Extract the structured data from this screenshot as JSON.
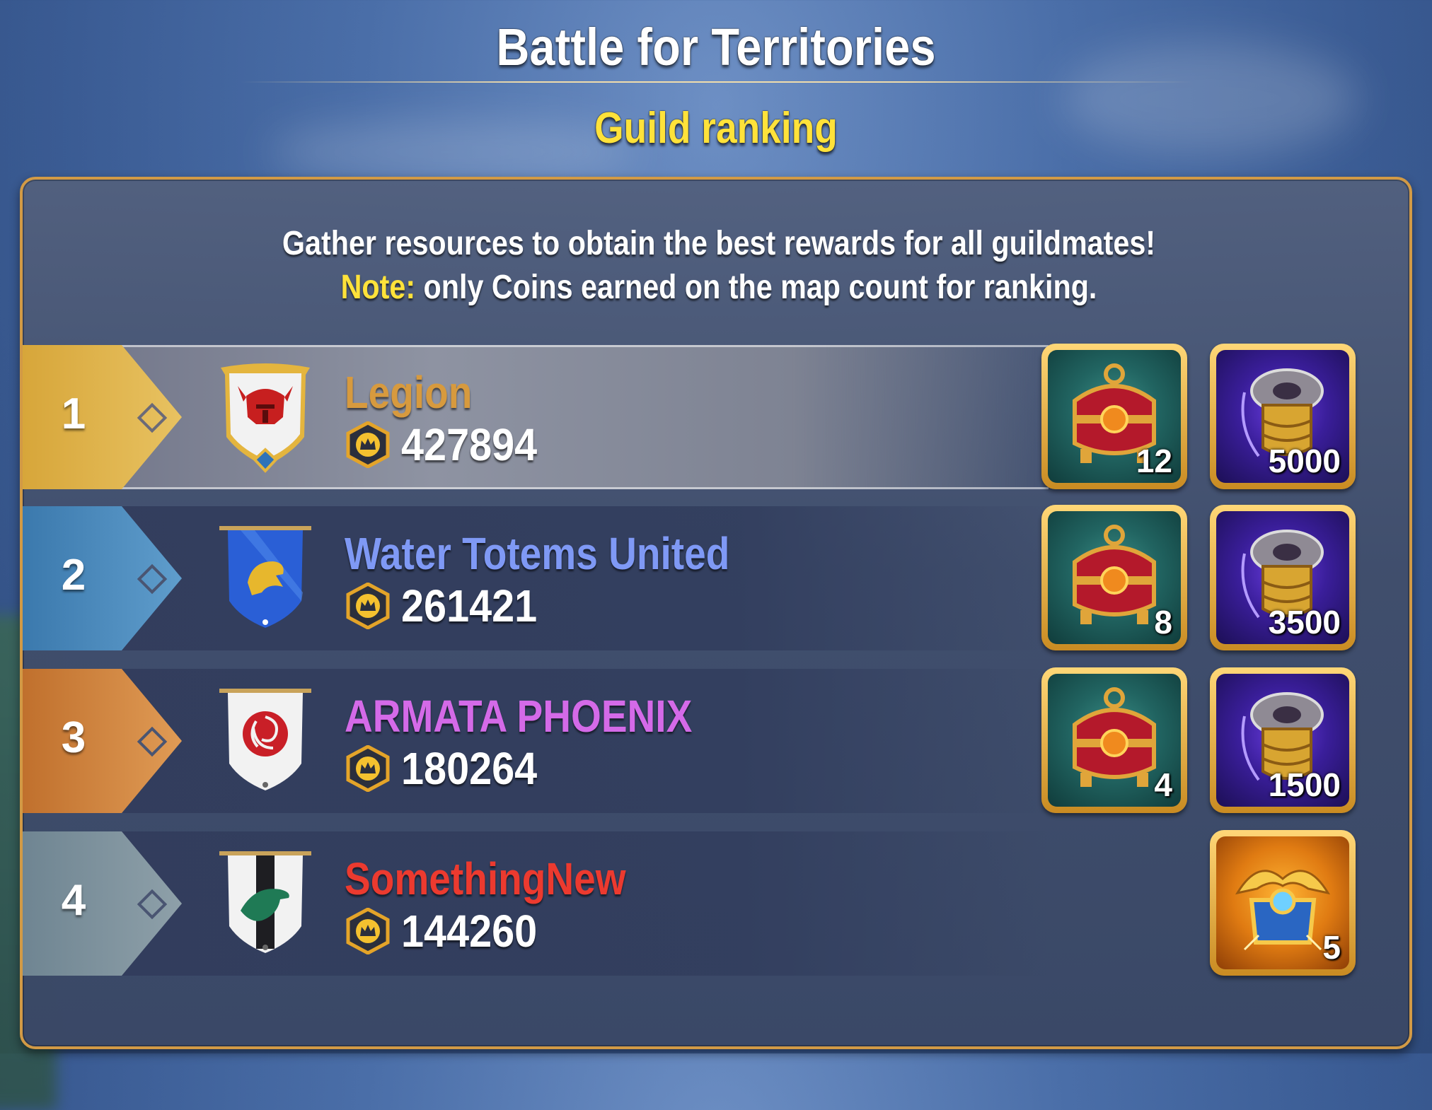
{
  "header": {
    "title": "Battle for Territories",
    "subtitle": "Guild ranking"
  },
  "description": {
    "line1": "Gather resources to obtain the best rewards for all guildmates!",
    "note_label": "Note:",
    "note_text": " only Coins earned on the map count for ranking."
  },
  "colors": {
    "accent_gold": "#ffe23a",
    "panel_border": "#d29a45"
  },
  "guilds": [
    {
      "rank": "1",
      "name": "Legion",
      "name_color": "#d79a3e",
      "score": "427894",
      "banner": "red-helmet-banner-icon",
      "rewards": [
        {
          "type": "chest",
          "icon": "red-chest-icon",
          "qty": "12"
        },
        {
          "type": "emblem",
          "icon": "titan-spark-icon",
          "qty": "5000"
        }
      ]
    },
    {
      "rank": "2",
      "name": "Water Totems United",
      "name_color": "#7f99f5",
      "score": "261421",
      "banner": "blue-wolf-banner-icon",
      "rewards": [
        {
          "type": "chest",
          "icon": "red-chest-icon",
          "qty": "8"
        },
        {
          "type": "emblem",
          "icon": "titan-spark-icon",
          "qty": "3500"
        }
      ]
    },
    {
      "rank": "3",
      "name": "ARMATA PHOENIX",
      "name_color": "#d46ae8",
      "score": "180264",
      "banner": "red-swirl-banner-icon",
      "rewards": [
        {
          "type": "chest",
          "icon": "red-chest-icon",
          "qty": "4"
        },
        {
          "type": "emblem",
          "icon": "titan-spark-icon",
          "qty": "1500"
        }
      ]
    },
    {
      "rank": "4",
      "name": "SomethingNew",
      "name_color": "#ec3a2f",
      "score": "144260",
      "banner": "green-bird-banner-icon",
      "rewards": [
        {
          "type": "gold",
          "icon": "winged-chest-icon",
          "qty": "5"
        }
      ]
    }
  ]
}
